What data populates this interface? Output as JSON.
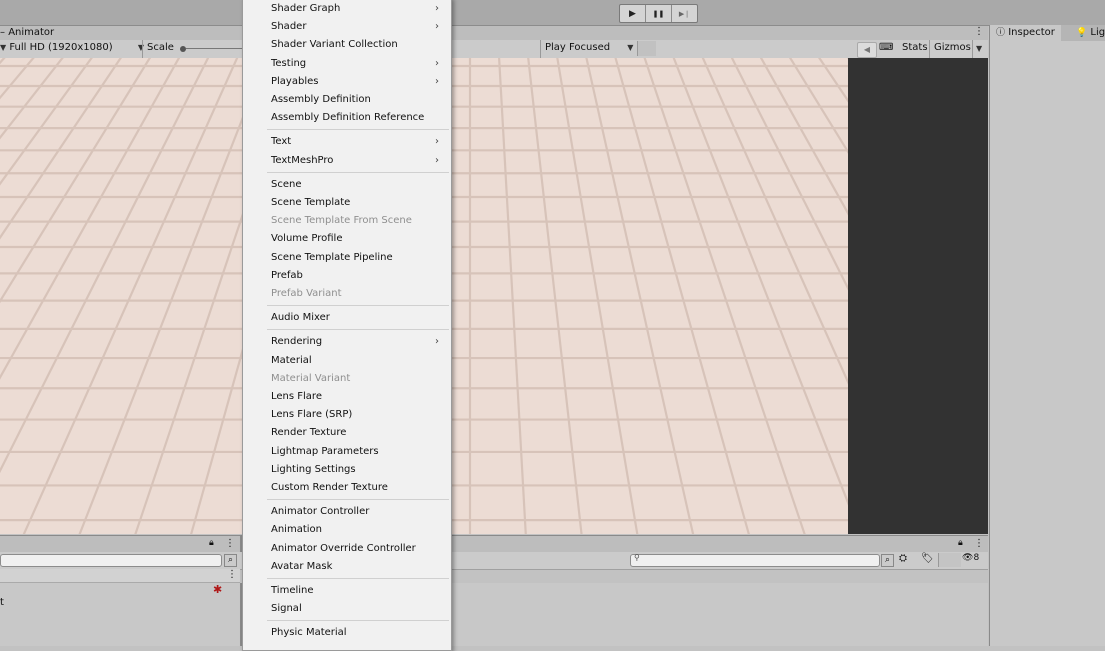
{
  "toolbar": {
    "play_icon": "▶",
    "pause_icon": "❚❚",
    "step_icon": "▶❘"
  },
  "game_view": {
    "tab_label": "Animator",
    "resolution": "Full HD (1920x1080)",
    "scale_label": "Scale",
    "play_mode": "Play Focused",
    "stats_label": "Stats",
    "gizmos_label": "Gizmos",
    "more_icon": "⋮"
  },
  "inspector": {
    "tab_inspector": "Inspector",
    "tab_lighting": "Ligh"
  },
  "bottom_panel": {
    "left_row_text": "t",
    "lock_icon": "🔒",
    "visibility_count": "8"
  },
  "context_menu": {
    "groups": [
      [
        {
          "label": "Shader Graph",
          "submenu": true,
          "disabled": false
        },
        {
          "label": "Shader",
          "submenu": true,
          "disabled": false
        },
        {
          "label": "Shader Variant Collection",
          "submenu": false,
          "disabled": false
        },
        {
          "label": "Testing",
          "submenu": true,
          "disabled": false
        },
        {
          "label": "Playables",
          "submenu": true,
          "disabled": false
        },
        {
          "label": "Assembly Definition",
          "submenu": false,
          "disabled": false
        },
        {
          "label": "Assembly Definition Reference",
          "submenu": false,
          "disabled": false
        }
      ],
      [
        {
          "label": "Text",
          "submenu": true,
          "disabled": false
        },
        {
          "label": "TextMeshPro",
          "submenu": true,
          "disabled": false
        }
      ],
      [
        {
          "label": "Scene",
          "submenu": false,
          "disabled": false
        },
        {
          "label": "Scene Template",
          "submenu": false,
          "disabled": false
        },
        {
          "label": "Scene Template From Scene",
          "submenu": false,
          "disabled": true
        },
        {
          "label": "Volume Profile",
          "submenu": false,
          "disabled": false
        },
        {
          "label": "Scene Template Pipeline",
          "submenu": false,
          "disabled": false
        },
        {
          "label": "Prefab",
          "submenu": false,
          "disabled": false
        },
        {
          "label": "Prefab Variant",
          "submenu": false,
          "disabled": true
        }
      ],
      [
        {
          "label": "Audio Mixer",
          "submenu": false,
          "disabled": false
        }
      ],
      [
        {
          "label": "Rendering",
          "submenu": true,
          "disabled": false
        },
        {
          "label": "Material",
          "submenu": false,
          "disabled": false
        },
        {
          "label": "Material Variant",
          "submenu": false,
          "disabled": true
        },
        {
          "label": "Lens Flare",
          "submenu": false,
          "disabled": false
        },
        {
          "label": "Lens Flare (SRP)",
          "submenu": false,
          "disabled": false
        },
        {
          "label": "Render Texture",
          "submenu": false,
          "disabled": false
        },
        {
          "label": "Lightmap Parameters",
          "submenu": false,
          "disabled": false
        },
        {
          "label": "Lighting Settings",
          "submenu": false,
          "disabled": false
        },
        {
          "label": "Custom Render Texture",
          "submenu": false,
          "disabled": false
        }
      ],
      [
        {
          "label": "Animator Controller",
          "submenu": false,
          "disabled": false
        },
        {
          "label": "Animation",
          "submenu": false,
          "disabled": false
        },
        {
          "label": "Animator Override Controller",
          "submenu": false,
          "disabled": false
        },
        {
          "label": "Avatar Mask",
          "submenu": false,
          "disabled": false
        }
      ],
      [
        {
          "label": "Timeline",
          "submenu": false,
          "disabled": false
        },
        {
          "label": "Signal",
          "submenu": false,
          "disabled": false
        }
      ],
      [
        {
          "label": "Physic Material",
          "submenu": false,
          "disabled": false
        }
      ]
    ]
  }
}
